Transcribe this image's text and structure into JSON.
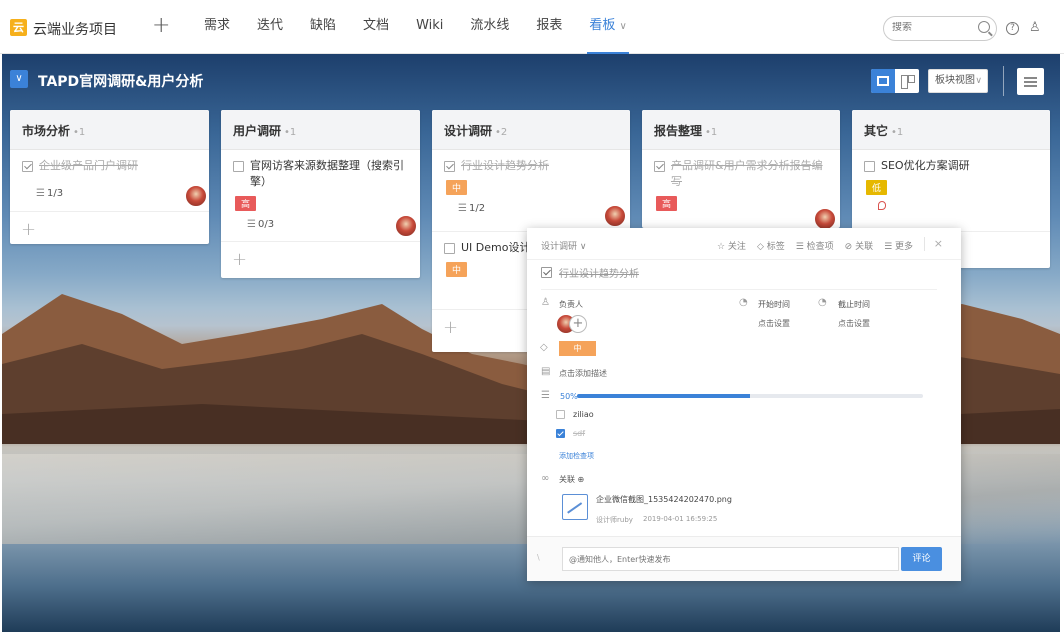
{
  "header": {
    "project_name": "云端业务项目",
    "plus": "+",
    "nav": [
      {
        "label": "需求",
        "active": false
      },
      {
        "label": "迭代",
        "active": false
      },
      {
        "label": "缺陷",
        "active": false
      },
      {
        "label": "文档",
        "active": false
      },
      {
        "label": "Wiki",
        "active": false
      },
      {
        "label": "流水线",
        "active": false
      },
      {
        "label": "报表",
        "active": false
      },
      {
        "label": "看板",
        "active": true
      }
    ],
    "search_placeholder": "搜索",
    "logo_glyph": "云",
    "help_glyph": "?"
  },
  "board": {
    "title": "TAPD官网调研&用户分析",
    "view_select": "板块视图",
    "accent_color": "#3b82d8"
  },
  "columns": [
    {
      "name": "市场分析",
      "count": "1",
      "cards": [
        {
          "title": "企业级产品门户调研",
          "done": true,
          "checklist": "1/3",
          "tag": "",
          "avatar": true
        }
      ]
    },
    {
      "name": "用户调研",
      "count": "1",
      "cards": [
        {
          "title": "官网访客来源数据整理（搜索引擎）",
          "done": false,
          "tag": "高",
          "tag_level": "high",
          "checklist": "0/3",
          "avatar": true
        }
      ]
    },
    {
      "name": "设计调研",
      "count": "2",
      "cards": [
        {
          "title": "行业设计趋势分析",
          "done": true,
          "tag": "中",
          "tag_level": "mid",
          "checklist": "1/2",
          "avatar": true
        },
        {
          "title": "UI Demo设计",
          "done": false,
          "tag": "中",
          "tag_level": "mid",
          "checklist": "",
          "avatar": false
        }
      ]
    },
    {
      "name": "报告整理",
      "count": "1",
      "cards": [
        {
          "title": "产品调研&用户需求分析报告编写",
          "done": true,
          "tag": "高",
          "tag_level": "high",
          "checklist": "",
          "avatar": true
        }
      ]
    },
    {
      "name": "其它",
      "count": "1",
      "cards": [
        {
          "title": "SEO优化方案调研",
          "done": false,
          "tag": "低",
          "tag_level": "low",
          "checklist": "",
          "avatar": false
        }
      ]
    }
  ],
  "detail": {
    "crumb": "设计调研",
    "actions": [
      "☆ 关注",
      "◇ 标签",
      "☰ 检查项",
      "⊘ 关联",
      "☰ 更多"
    ],
    "close": "×",
    "title": "行业设计趋势分析",
    "owner_label": "负责人",
    "start_label": "开始时间",
    "start_value": "点击设置",
    "end_label": "截止时间",
    "end_value": "点击设置",
    "priority_tag": "中",
    "description_placeholder": "点击添加描述",
    "progress_text": "50%",
    "progress": 0.5,
    "checklist": [
      {
        "label": "ziliao",
        "checked": false
      },
      {
        "label": "sdf",
        "checked": true
      }
    ],
    "add_check": "添加检查项",
    "relation_label": "关联 ⊕",
    "attachment_name": "企业微信截图_1535424202470.png",
    "attachment_author": "设计师ruby",
    "attachment_time": "2019-04-01 16:59:25",
    "comment_placeholder": "@通知他人，Enter快速发布",
    "comment_button": "评论",
    "mention_icon": "\\"
  }
}
